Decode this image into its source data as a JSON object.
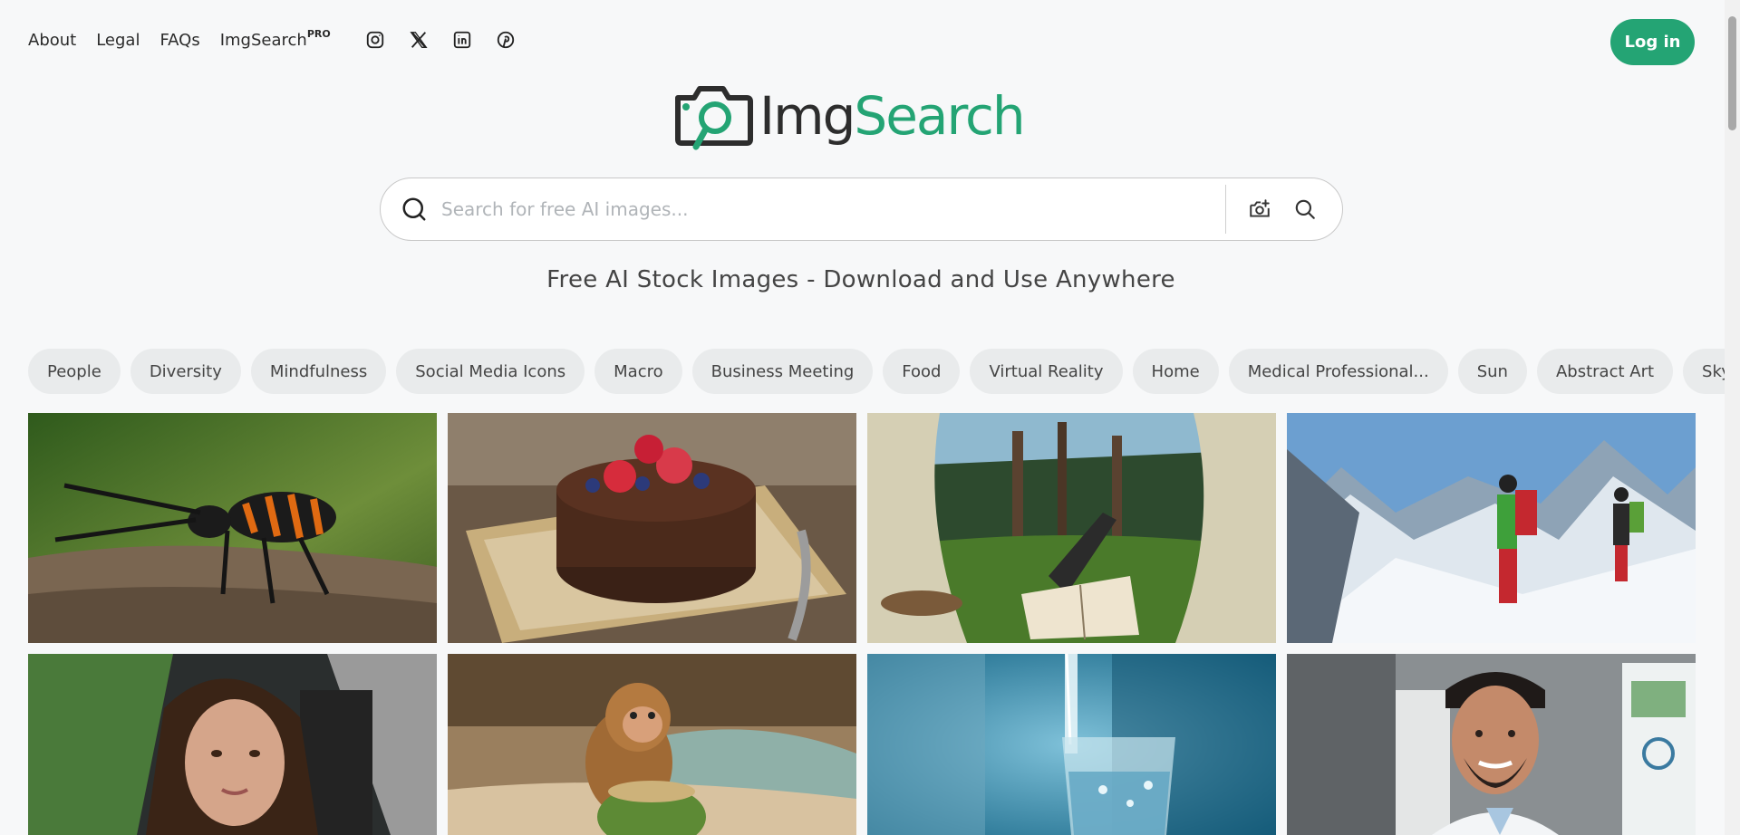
{
  "nav": {
    "links": [
      "About",
      "Legal",
      "FAQs",
      "ImgSearch"
    ],
    "pro_badge": "PRO",
    "social_icons": [
      "instagram-icon",
      "x-icon",
      "linkedin-icon",
      "pinterest-icon"
    ]
  },
  "login_label": "Log in",
  "logo": {
    "part1": "Img",
    "part2": "Search"
  },
  "search": {
    "placeholder": "Search for free AI images..."
  },
  "tagline": "Free AI Stock Images - Download and Use Anywhere",
  "chips": [
    "People",
    "Diversity",
    "Mindfulness",
    "Social Media Icons",
    "Macro",
    "Business Meeting",
    "Food",
    "Virtual Reality",
    "Home",
    "Medical Professional...",
    "Sun",
    "Abstract Art",
    "Sky"
  ],
  "images": [
    "orange-black-beetle-photo",
    "chocolate-berry-cake-photo",
    "reading-in-tent-forest-photo",
    "mountain-hikers-snow-photo",
    "woman-in-car-photo",
    "monkey-on-coconut-photo",
    "water-glass-pour-photo",
    "smiling-doctor-photo"
  ],
  "colors": {
    "accent": "#24a474",
    "background": "#f7f8f9",
    "chip": "#e9ebec"
  }
}
